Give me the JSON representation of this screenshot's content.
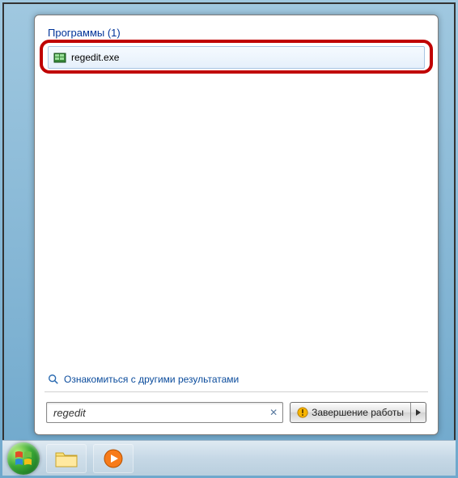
{
  "category": {
    "label": "Программы (1)"
  },
  "result": {
    "label": "regedit.exe",
    "icon": "regedit-icon"
  },
  "more_results": {
    "label": "Ознакомиться с другими результатами"
  },
  "search": {
    "value": "regedit"
  },
  "shutdown": {
    "label": "Завершение работы"
  },
  "colors": {
    "highlight_border": "#c00000",
    "link": "#0a4b9c",
    "header": "#003399"
  }
}
